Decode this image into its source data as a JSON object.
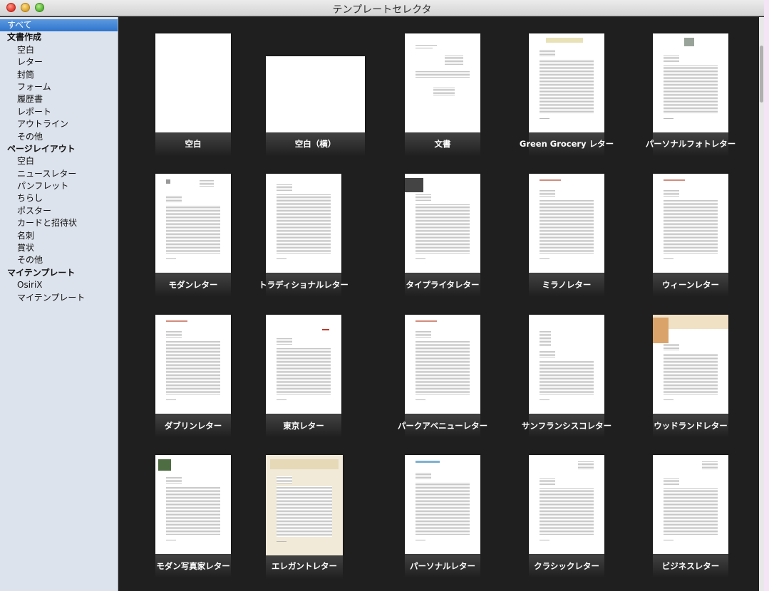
{
  "window": {
    "title": "テンプレートセレクタ"
  },
  "colors": {
    "sidebar_bg": "#dde3ec",
    "selection": "#3a7fd4",
    "grid_bg": "#1f1f1f",
    "label": "#ffffff"
  },
  "sidebar": {
    "items": [
      {
        "label": "すべて",
        "level": 0,
        "selected": true
      },
      {
        "label": "文書作成",
        "level": 0,
        "group": true
      },
      {
        "label": "空白",
        "level": 1
      },
      {
        "label": "レター",
        "level": 1
      },
      {
        "label": "封筒",
        "level": 1
      },
      {
        "label": "フォーム",
        "level": 1
      },
      {
        "label": "履歴書",
        "level": 1
      },
      {
        "label": "レポート",
        "level": 1
      },
      {
        "label": "アウトライン",
        "level": 1
      },
      {
        "label": "その他",
        "level": 1
      },
      {
        "label": "ページレイアウト",
        "level": 0,
        "group": true
      },
      {
        "label": "空白",
        "level": 1
      },
      {
        "label": "ニュースレター",
        "level": 1
      },
      {
        "label": "パンフレット",
        "level": 1
      },
      {
        "label": "ちらし",
        "level": 1
      },
      {
        "label": "ポスター",
        "level": 1
      },
      {
        "label": "カードと招待状",
        "level": 1
      },
      {
        "label": "名刺",
        "level": 1
      },
      {
        "label": "賞状",
        "level": 1
      },
      {
        "label": "その他",
        "level": 1
      },
      {
        "label": "マイテンプレート",
        "level": 0,
        "group": true
      },
      {
        "label": "OsiriX",
        "level": 1
      },
      {
        "label": "マイテンプレート",
        "level": 1
      }
    ]
  },
  "templates": [
    {
      "label": "空白",
      "style": "blank"
    },
    {
      "label": "空白（横）",
      "style": "blank-landscape"
    },
    {
      "label": "文書",
      "style": "document"
    },
    {
      "label": "Green Grocery レター",
      "style": "green-grocery"
    },
    {
      "label": "パーソナルフォトレター",
      "style": "personal-photo"
    },
    {
      "label": "モダンレター",
      "style": "modern"
    },
    {
      "label": "トラディショナルレター",
      "style": "traditional"
    },
    {
      "label": "タイプライタレター",
      "style": "typewriter"
    },
    {
      "label": "ミラノレター",
      "style": "milano"
    },
    {
      "label": "ウィーンレター",
      "style": "vienna"
    },
    {
      "label": "ダブリンレター",
      "style": "dublin"
    },
    {
      "label": "東京レター",
      "style": "tokyo"
    },
    {
      "label": "パークアベニューレター",
      "style": "park-avenue"
    },
    {
      "label": "サンフランシスコレター",
      "style": "san-francisco"
    },
    {
      "label": "ウッドランドレター",
      "style": "woodland"
    },
    {
      "label": "モダン写真家レター",
      "style": "modern-photographer"
    },
    {
      "label": "エレガントレター",
      "style": "elegant"
    },
    {
      "label": "パーソナルレター",
      "style": "personal"
    },
    {
      "label": "クラシックレター",
      "style": "classic"
    },
    {
      "label": "ビジネスレター",
      "style": "business"
    }
  ]
}
